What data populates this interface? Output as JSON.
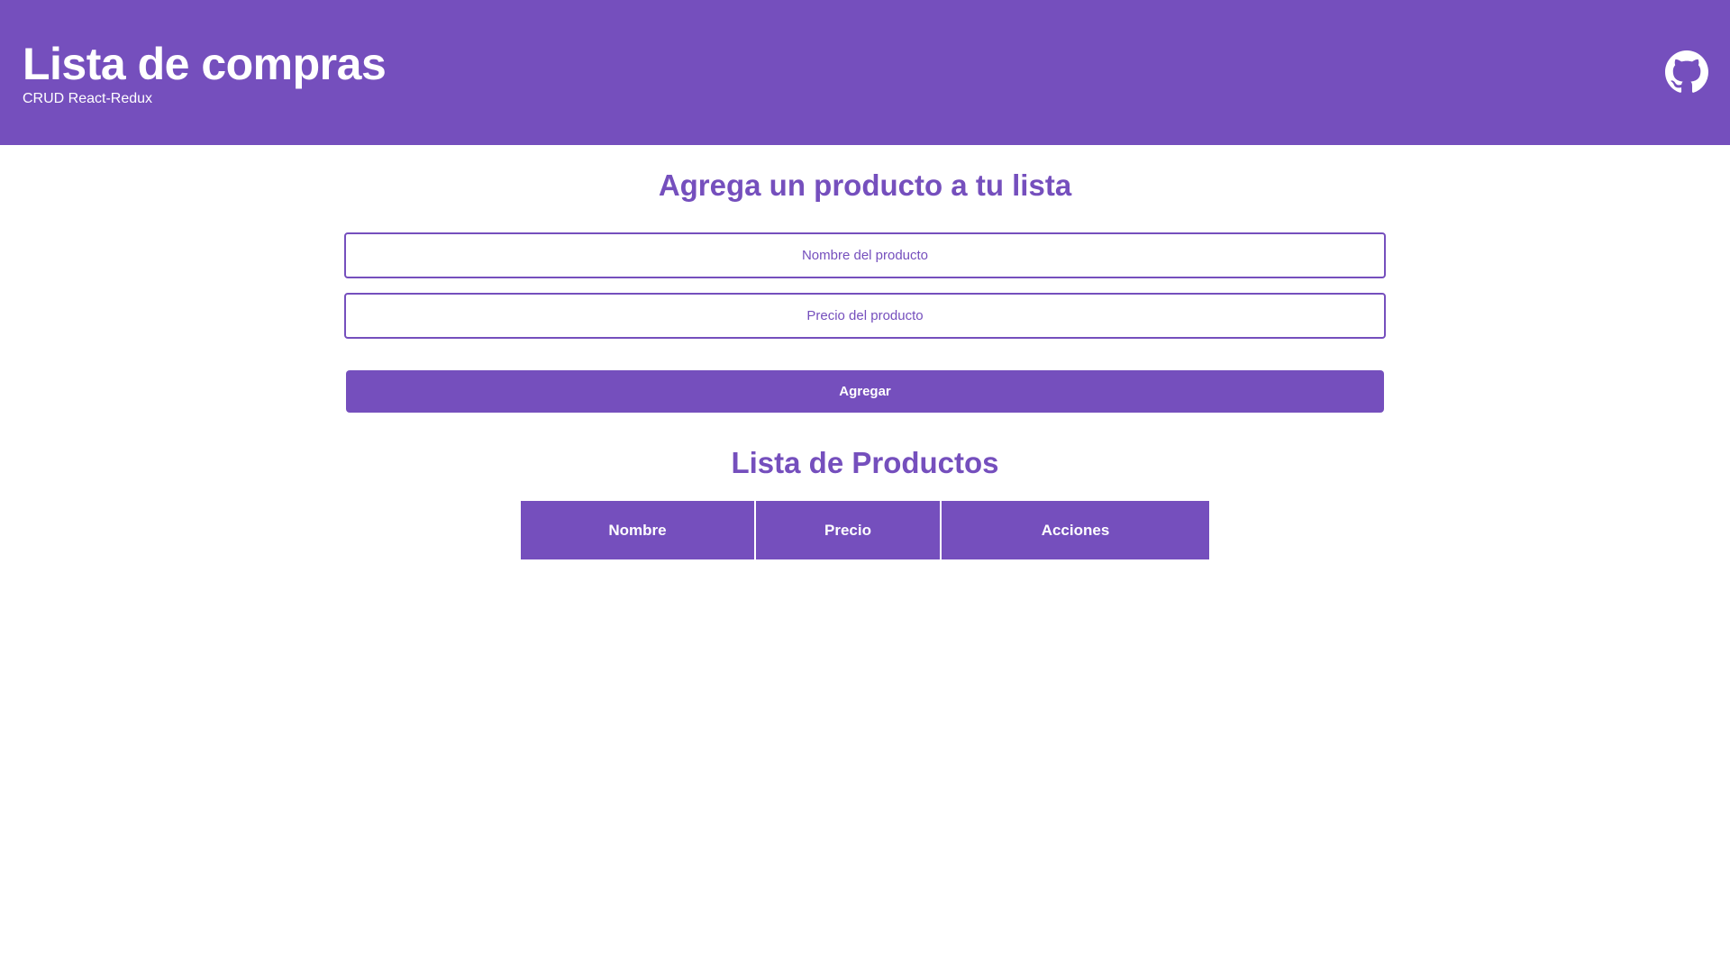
{
  "header": {
    "title": "Lista de compras",
    "subtitle": "CRUD React-Redux",
    "github_icon": "github-icon"
  },
  "form": {
    "title": "Agrega un producto a tu lista",
    "name_placeholder": "Nombre del producto",
    "name_value": "",
    "price_placeholder": "Precio del producto",
    "price_value": "",
    "submit_label": "Agregar"
  },
  "list": {
    "title": "Lista de Productos",
    "columns": [
      "Nombre",
      "Precio",
      "Acciones"
    ],
    "rows": []
  },
  "colors": {
    "accent": "#754fbd",
    "background": "#ffffff",
    "text_on_accent": "#ffffff"
  }
}
